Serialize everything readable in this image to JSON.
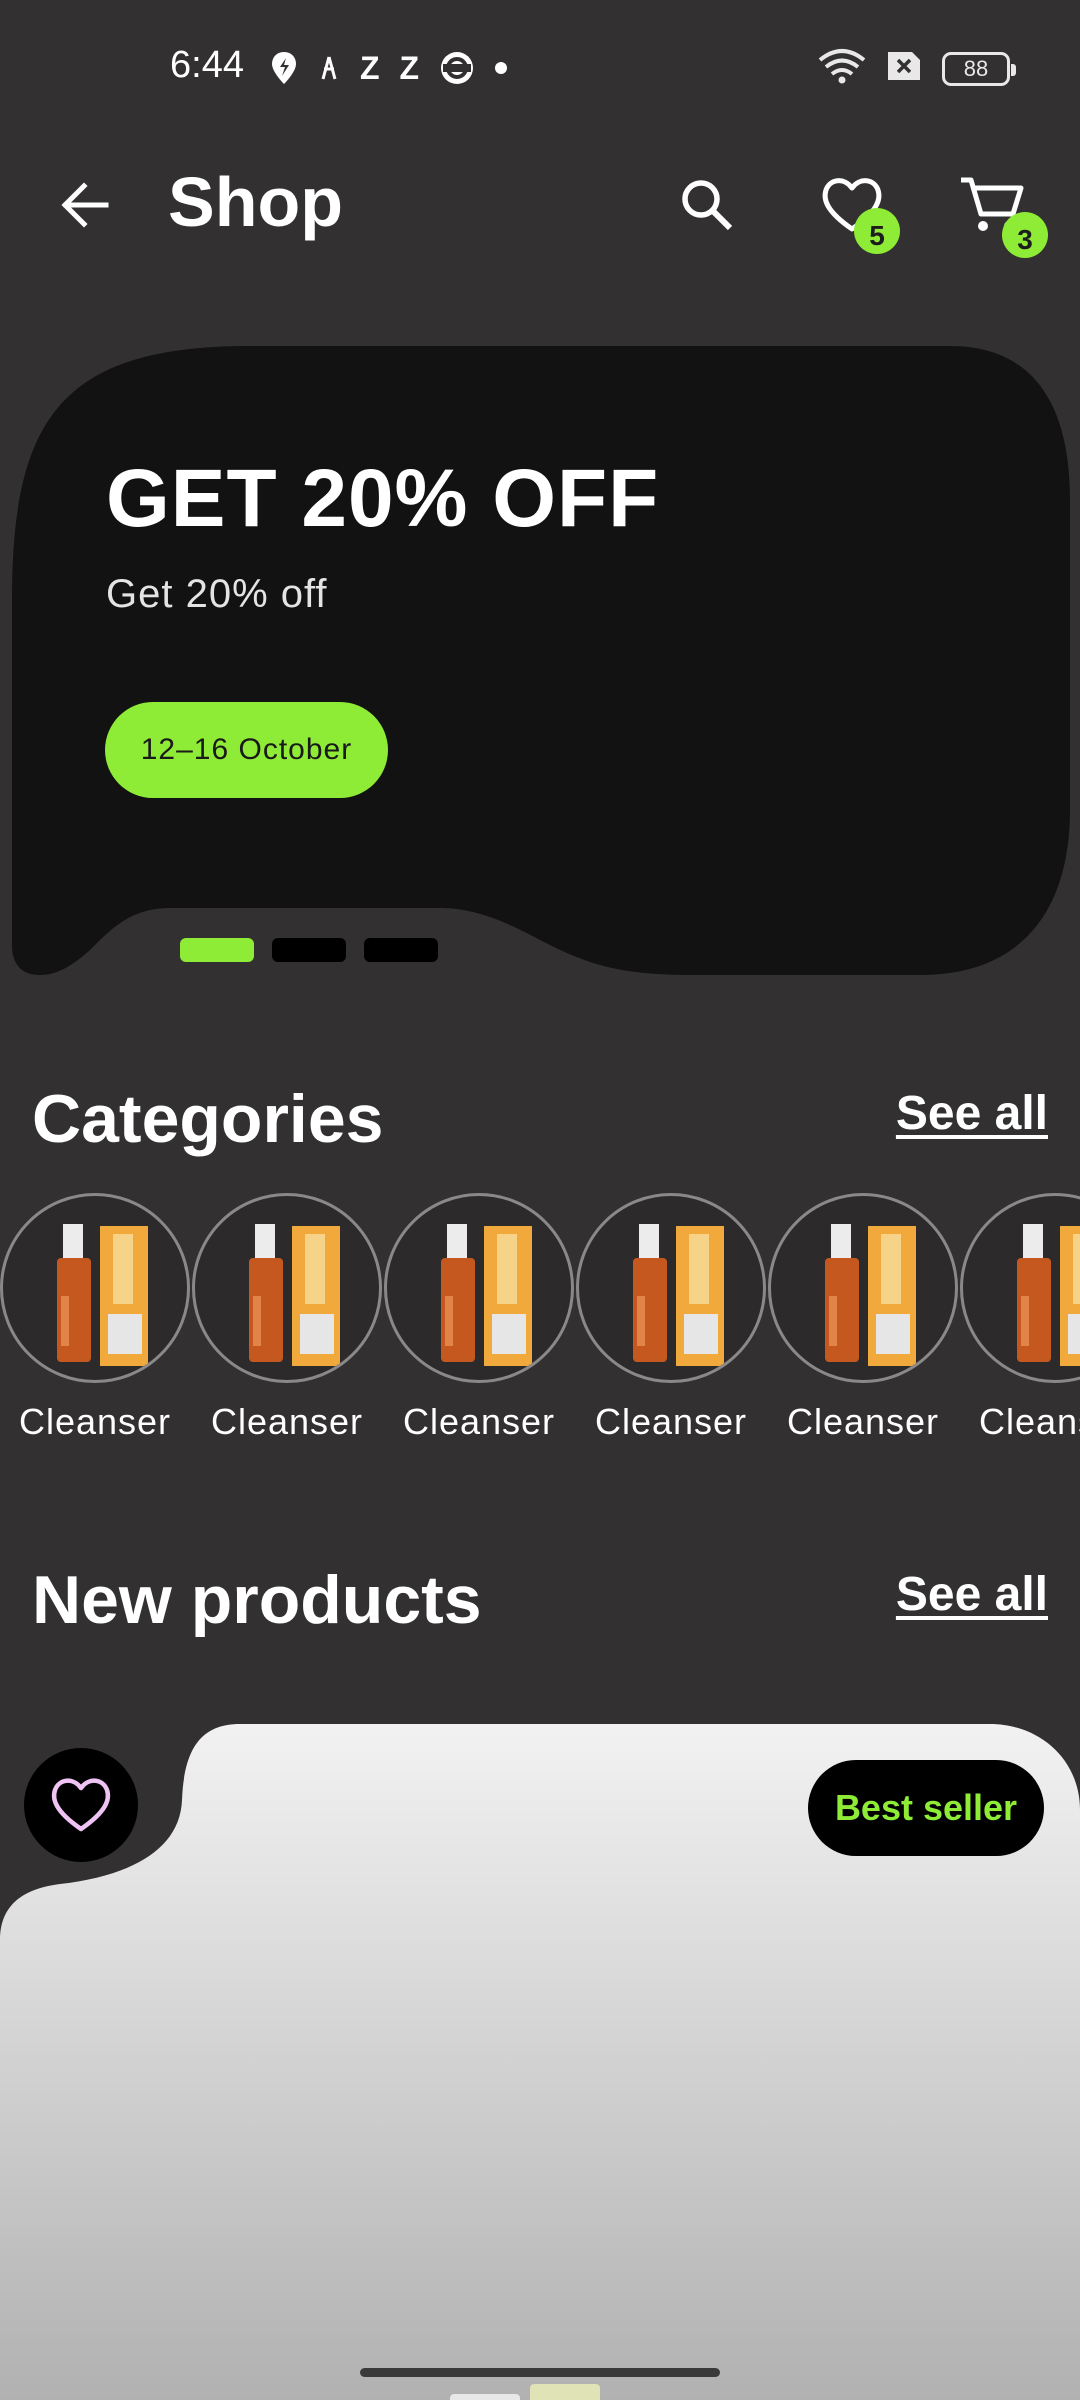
{
  "status_bar": {
    "time": "6:44",
    "notification_letters": [
      "Z",
      "Z"
    ],
    "battery_level": "88"
  },
  "app_bar": {
    "title": "Shop",
    "wishlist_count": "5",
    "cart_count": "3"
  },
  "promo": {
    "title": "GET 20% OFF",
    "subtitle": "Get 20% off",
    "date_chip": "12–16 October",
    "pager": {
      "count": 3,
      "active_index": 0
    }
  },
  "categories": {
    "title": "Categories",
    "see_all": "See all",
    "items": [
      {
        "label": "Cleanser"
      },
      {
        "label": "Cleanser"
      },
      {
        "label": "Cleanser"
      },
      {
        "label": "Cleanser"
      },
      {
        "label": "Cleanser"
      },
      {
        "label": "Cleanser"
      }
    ]
  },
  "new_products": {
    "title": "New products",
    "see_all": "See all",
    "first_product": {
      "badge": "Best seller"
    }
  },
  "colors": {
    "background": "#323031",
    "accent": "#8eeb36",
    "banner": "#121212"
  }
}
